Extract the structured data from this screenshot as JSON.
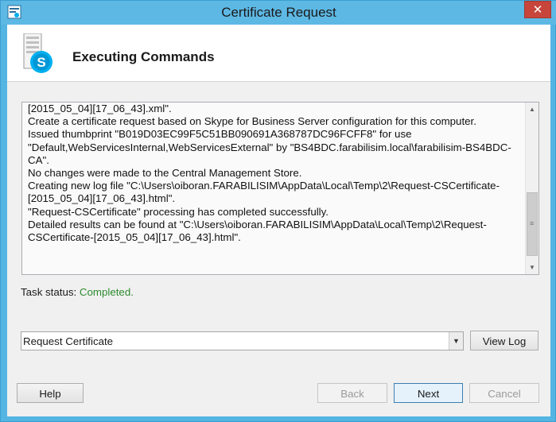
{
  "window": {
    "title": "Certificate Request",
    "close_glyph": "✕",
    "app_icon": "certificate-app-icon"
  },
  "header": {
    "title": "Executing Commands",
    "icon": "skype-server-icon"
  },
  "log": {
    "lines": [
      "[2015_05_04][17_06_43].xml\".",
      "Create a certificate request based on Skype for Business Server configuration for this computer.",
      "Issued thumbprint \"B019D03EC99F5C51BB090691A368787DC96FCFF8\" for use",
      "\"Default,WebServicesInternal,WebServicesExternal\" by \"BS4BDC.farabilisim.local\\farabilisim-BS4BDC-",
      "CA\".",
      "No changes were made to the Central Management Store.",
      "Creating new log file \"C:\\Users\\oiboran.FARABILISIM\\AppData\\Local\\Temp\\2\\Request-CSCertificate-",
      "[2015_05_04][17_06_43].html\".",
      "\"Request-CSCertificate\" processing has completed successfully.",
      "Detailed results can be found at \"C:\\Users\\oiboran.FARABILISIM\\AppData\\Local\\Temp\\2\\Request-",
      "CSCertificate-[2015_05_04][17_06_43].html\"."
    ],
    "scroll_up": "▲",
    "scroll_down": "▼",
    "scroll_grip": "≡"
  },
  "task_status": {
    "label": "Task status: ",
    "value": "Completed."
  },
  "action_select": {
    "value": "Request Certificate",
    "arrow": "▼"
  },
  "buttons": {
    "view_log": "View Log",
    "help": "Help",
    "back": "Back",
    "next": "Next",
    "cancel": "Cancel"
  },
  "colors": {
    "title_bar": "#5db8e4",
    "status_ok": "#2e8b2e",
    "close": "#c7453b",
    "skype_blue": "#00aff0"
  }
}
